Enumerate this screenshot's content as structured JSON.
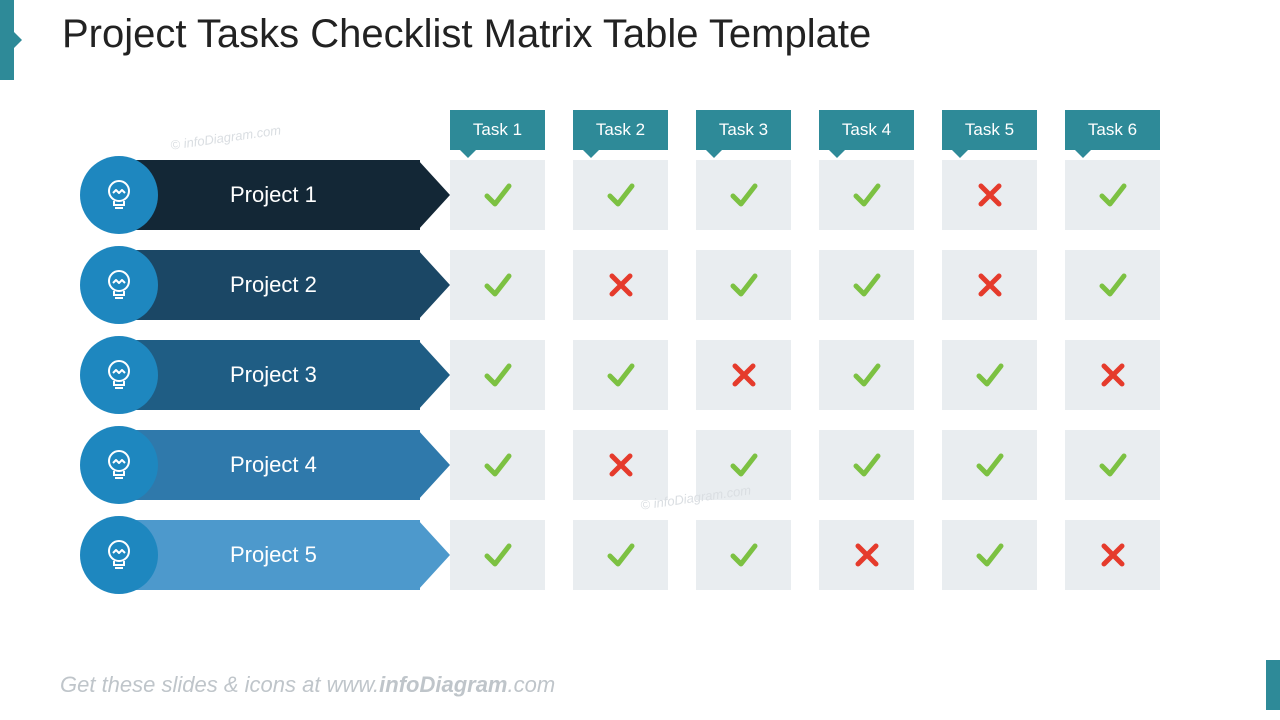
{
  "title": "Project Tasks Checklist Matrix Table Template",
  "footer_pre": "Get these slides & icons at www.",
  "footer_bold": "infoDiagram",
  "footer_post": ".com",
  "watermark": "© infoDiagram.com",
  "colors": {
    "accent": "#2e8a98",
    "rowBg": "#c7ced4",
    "cellBg": "#e9edf0",
    "check": "#7cc142",
    "cross": "#e53b2c"
  },
  "tasks": [
    "Task 1",
    "Task 2",
    "Task 3",
    "Task 4",
    "Task 5",
    "Task 6"
  ],
  "rows": [
    {
      "label": "Project 1",
      "circle": "#1e87bf",
      "arrow": "#132736",
      "vals": [
        "y",
        "y",
        "y",
        "y",
        "n",
        "y"
      ]
    },
    {
      "label": "Project 2",
      "circle": "#1e87bf",
      "arrow": "#1b4765",
      "vals": [
        "y",
        "n",
        "y",
        "y",
        "n",
        "y"
      ]
    },
    {
      "label": "Project 3",
      "circle": "#1e87bf",
      "arrow": "#1f5d84",
      "vals": [
        "y",
        "y",
        "n",
        "y",
        "y",
        "n"
      ]
    },
    {
      "label": "Project 4",
      "circle": "#1e87bf",
      "arrow": "#2f79ab",
      "vals": [
        "y",
        "n",
        "y",
        "y",
        "y",
        "y"
      ]
    },
    {
      "label": "Project 5",
      "circle": "#1e87bf",
      "arrow": "#4d99cc",
      "vals": [
        "y",
        "y",
        "y",
        "n",
        "y",
        "n"
      ]
    }
  ]
}
